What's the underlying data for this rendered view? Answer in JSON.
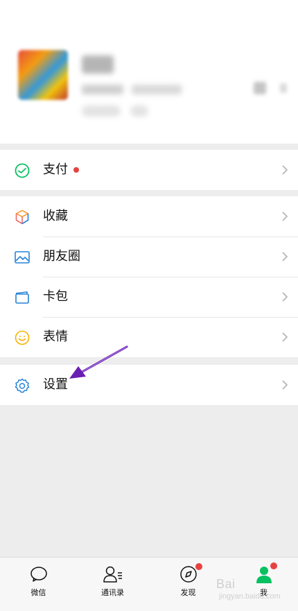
{
  "menu": {
    "pay": {
      "label": "支付",
      "icon": "wechat-pay-icon",
      "has_badge": true
    },
    "favorites": {
      "label": "收藏",
      "icon": "cube-icon"
    },
    "moments": {
      "label": "朋友圈",
      "icon": "image-icon"
    },
    "cards": {
      "label": "卡包",
      "icon": "card-icon"
    },
    "stickers": {
      "label": "表情",
      "icon": "smiley-icon"
    },
    "settings": {
      "label": "设置",
      "icon": "gear-icon"
    }
  },
  "tabbar": {
    "tabs": [
      {
        "label": "微信",
        "icon": "chat-icon"
      },
      {
        "label": "通讯录",
        "icon": "contacts-icon"
      },
      {
        "label": "发现",
        "icon": "compass-icon",
        "badge": true
      },
      {
        "label": "我",
        "icon": "me-icon",
        "badge": true,
        "active": true
      }
    ]
  },
  "colors": {
    "accent_green": "#07c160",
    "badge_red": "#e64340",
    "annotation_arrow": "#6a1fb3"
  },
  "watermark": {
    "text": "Bai",
    "subtext": "jingyan.baidu.com"
  }
}
